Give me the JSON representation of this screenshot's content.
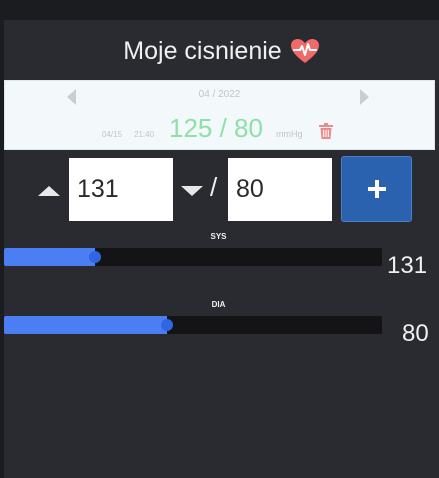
{
  "app": {
    "title": "Moje cisnienie"
  },
  "history": {
    "month": "04 / 2022",
    "entry": {
      "date": "04/15",
      "time": "21:40",
      "value": "125 / 80",
      "unit": "mmHg"
    }
  },
  "inputs": {
    "sys_value": "131",
    "separator": "/",
    "dia_value": "80"
  },
  "sliders": {
    "sys": {
      "label": "SYS",
      "value": "131",
      "fraction": 0.24
    },
    "dia": {
      "label": "DIA",
      "value": "80",
      "fraction": 0.43
    }
  },
  "icons": {
    "heart": "heartbeat-icon",
    "prev": "previous-month-icon",
    "next": "next-month-icon",
    "trash": "trash-icon",
    "up": "increase-icon",
    "down": "decrease-icon",
    "add": "plus-icon"
  },
  "colors": {
    "background": "#2a2b30",
    "accent": "#2b62b0",
    "heart": "#f06a6a",
    "value_green": "#8ee0a8",
    "slider_fill": "#4a7ef2",
    "trash": "#f08a8a"
  }
}
